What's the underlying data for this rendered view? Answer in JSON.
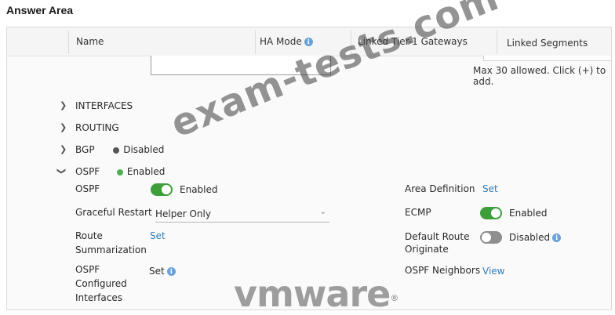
{
  "answer_area_title": "Answer Area",
  "table_header": {
    "name": "Name",
    "ha_mode": "HA Mode",
    "linked_tier1": "Linked Tier-1 Gateways",
    "linked_segments": "Linked Segments"
  },
  "hint_text": "Max 30 allowed. Click (+) to add.",
  "sections": {
    "interfaces": "INTERFACES",
    "routing": "ROUTING",
    "bgp": {
      "label": "BGP",
      "status": "Disabled",
      "status_color": "#555555"
    },
    "ospf": {
      "label": "OSPF",
      "status": "Enabled",
      "status_color": "#4caf50"
    }
  },
  "ospf_fields": {
    "ospf_label": "OSPF",
    "ospf_value": "Enabled",
    "graceful_restart_label": "Graceful Restart",
    "graceful_restart_value": "Helper Only",
    "route_summarization_line1": "Route",
    "route_summarization_line2": "Summarization",
    "route_summarization_action": "Set",
    "configured_interfaces_line1": "OSPF",
    "configured_interfaces_line2": "Configured",
    "configured_interfaces_line3": "Interfaces",
    "configured_interfaces_action": "Set",
    "area_definition_label": "Area Definition",
    "area_definition_action": "Set",
    "ecmp_label": "ECMP",
    "ecmp_value": "Enabled",
    "default_route_line1": "Default Route",
    "default_route_line2": "Originate",
    "default_route_value": "Disabled",
    "ospf_neighbors_label": "OSPF Neighbors",
    "ospf_neighbors_action": "View"
  },
  "watermark_text": "exam-tests.com",
  "logo_text": "vmware",
  "logo_mark": "®",
  "colors": {
    "toggle_on": "#3f9e3a",
    "toggle_off": "#8f8f8f",
    "link": "#2f7db8"
  }
}
